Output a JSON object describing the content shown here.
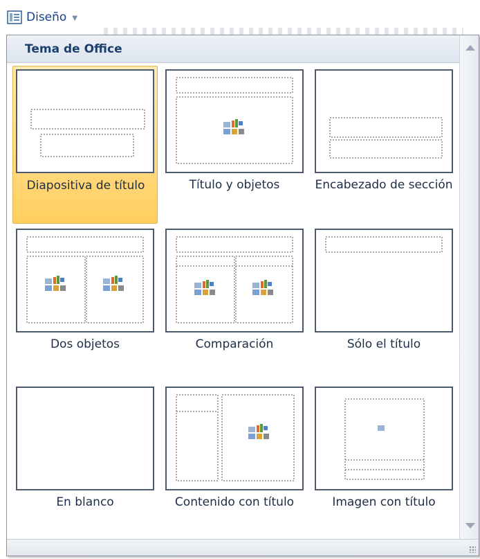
{
  "toolbar": {
    "button_label": "Diseño",
    "icon": "layout-icon",
    "dropdown_icon": "chevron-down-icon"
  },
  "gallery": {
    "section_title": "Tema de Office",
    "layouts": [
      {
        "label": "Diapositiva de título",
        "selected": true
      },
      {
        "label": "Título y objetos",
        "selected": false
      },
      {
        "label": "Encabezado de sección",
        "selected": false
      },
      {
        "label": "Dos objetos",
        "selected": false
      },
      {
        "label": "Comparación",
        "selected": false
      },
      {
        "label": "Sólo el título",
        "selected": false
      },
      {
        "label": "En blanco",
        "selected": false
      },
      {
        "label": "Contenido con título",
        "selected": false
      },
      {
        "label": "Imagen con título",
        "selected": false
      }
    ]
  },
  "colors": {
    "accent_text": "#15428b",
    "selected_fill": "#ffd778",
    "thumb_border": "#4d5a6b"
  }
}
